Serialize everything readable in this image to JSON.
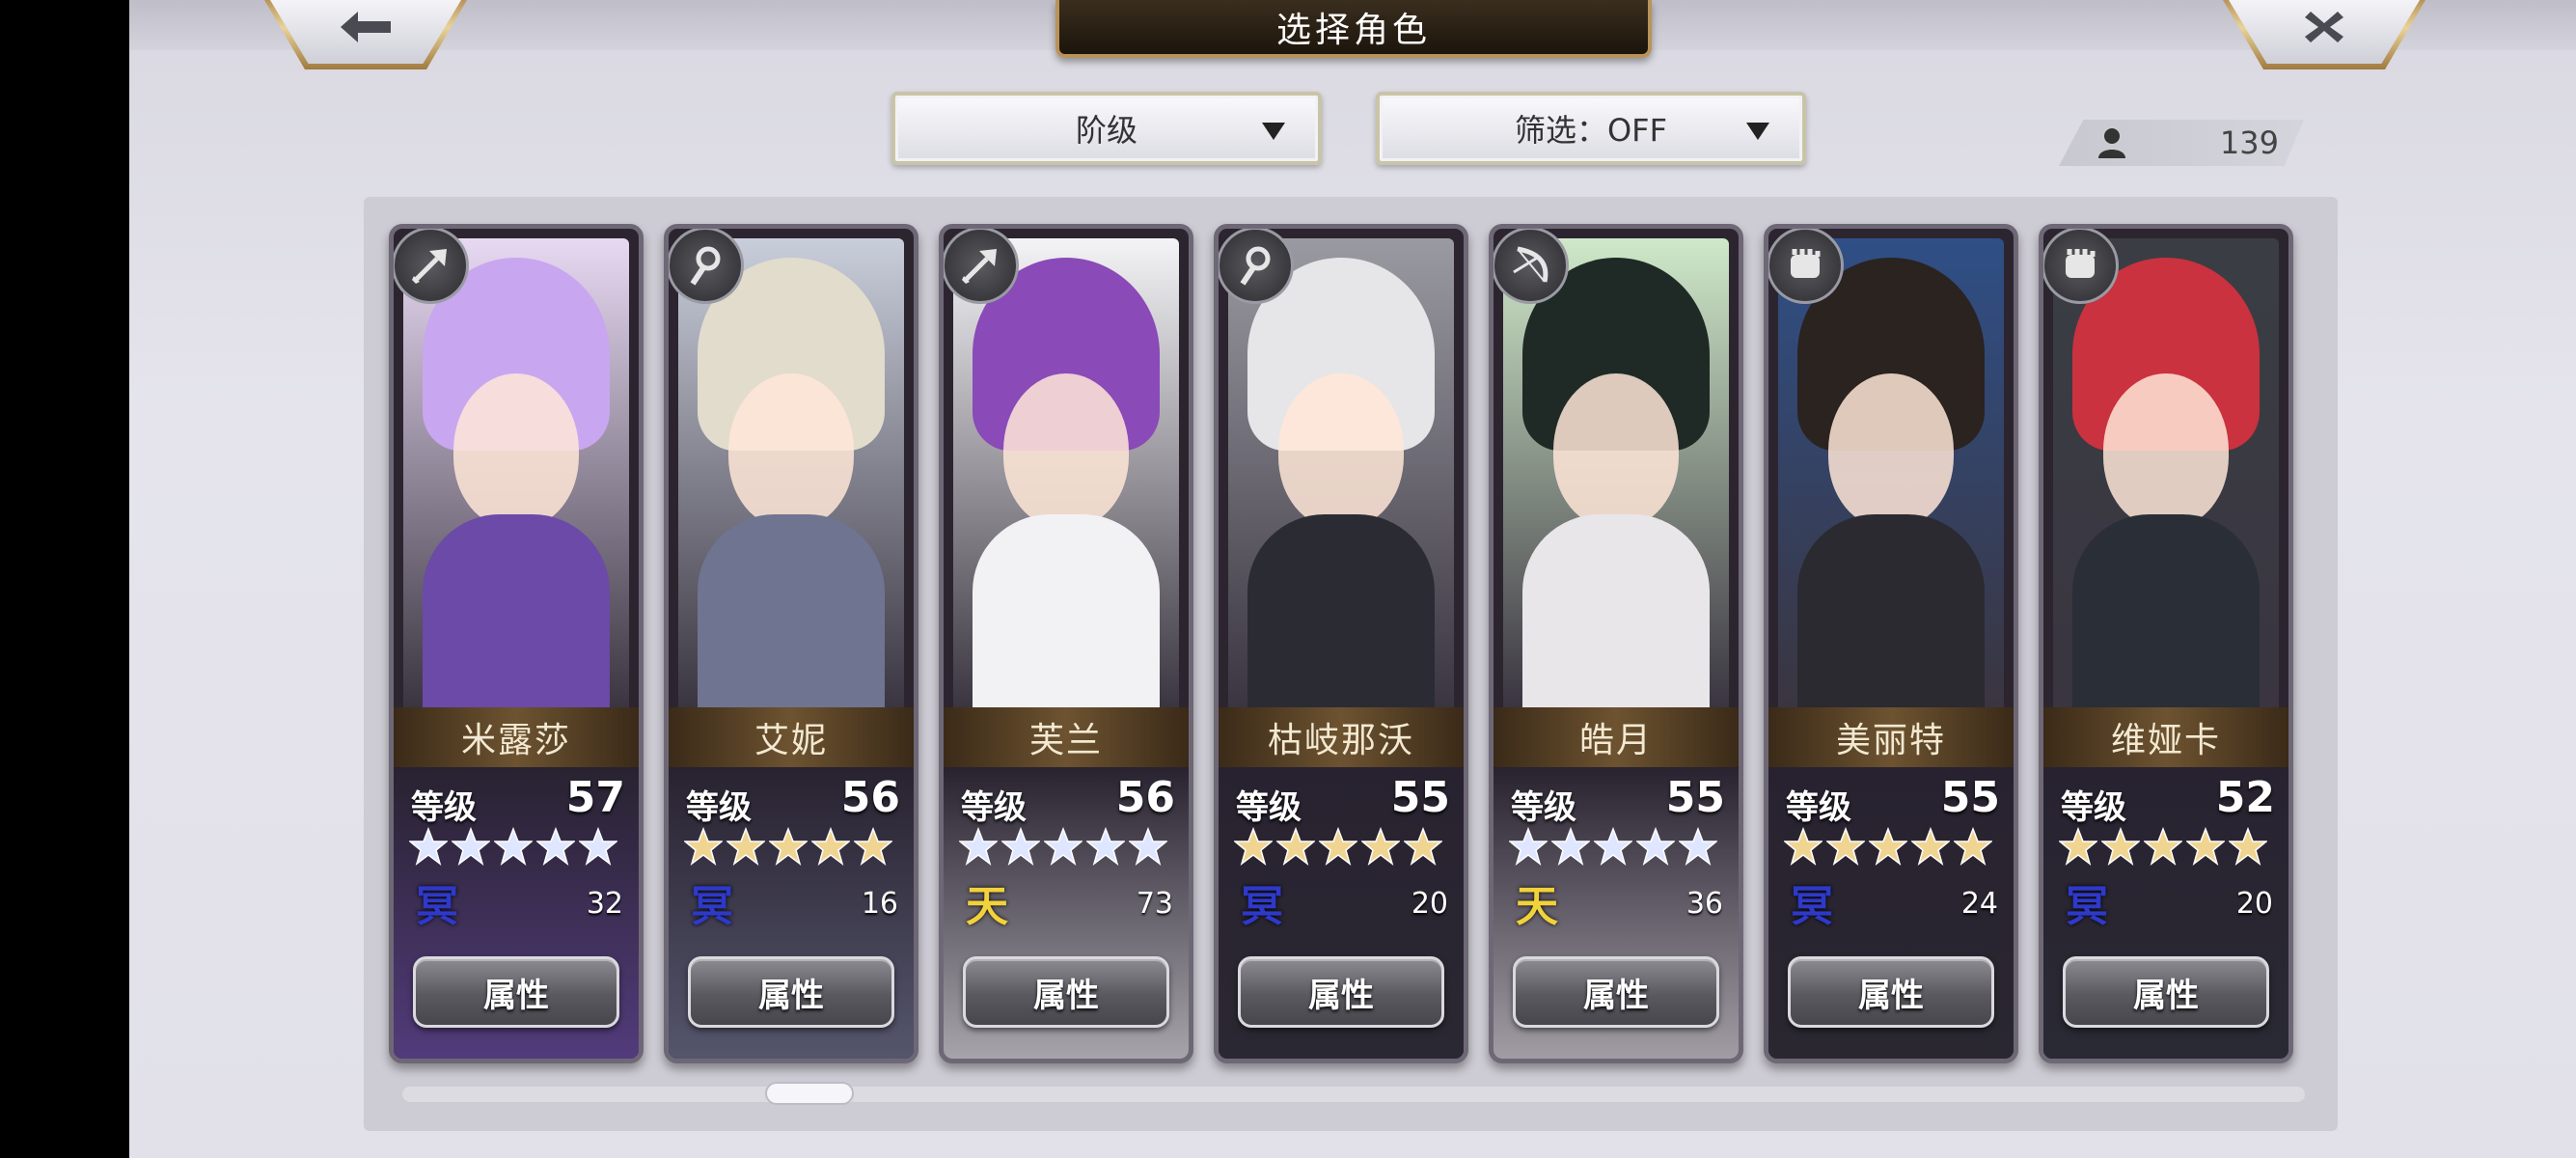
{
  "header": {
    "title": "选择角色",
    "back_icon": "arrow-left-icon",
    "close_icon": "close-icon"
  },
  "filters": {
    "rank_label": "阶级",
    "filter_label": "筛选：OFF"
  },
  "roster_count": "139",
  "characters": [
    {
      "name": "米露莎",
      "level_label": "等级",
      "level": "57",
      "stars": 5,
      "star_color": "#dfe6ff",
      "element_glyph": "冥",
      "element_color": "#2e39c9",
      "element_value": "32",
      "attr_label": "属性",
      "class_icon": "arrow-icon",
      "portrait": {
        "hair": "#c9a6f0",
        "body": "#6b4aa8",
        "bg": "#e7d9f2"
      }
    },
    {
      "name": "艾妮",
      "level_label": "等级",
      "level": "56",
      "stars": 5,
      "star_color": "#f0d592",
      "element_glyph": "冥",
      "element_color": "#2e39c9",
      "element_value": "16",
      "attr_label": "属性",
      "class_icon": "staff-icon",
      "portrait": {
        "hair": "#e2dccd",
        "body": "#6f7490",
        "bg": "#c9cedb"
      }
    },
    {
      "name": "芙兰",
      "level_label": "等级",
      "level": "56",
      "stars": 5,
      "star_color": "#dfe6ff",
      "element_glyph": "天",
      "element_color": "#f2d23b",
      "element_value": "73",
      "attr_label": "属性",
      "class_icon": "arrow-icon",
      "portrait": {
        "hair": "#8a4ab8",
        "body": "#f2f2f4",
        "bg": "#f4f4f6"
      }
    },
    {
      "name": "枯岐那沃",
      "level_label": "等级",
      "level": "55",
      "stars": 5,
      "star_color": "#f0d592",
      "element_glyph": "冥",
      "element_color": "#2e39c9",
      "element_value": "20",
      "attr_label": "属性",
      "class_icon": "staff-icon",
      "portrait": {
        "hair": "#e6e6e8",
        "body": "#2b2b33",
        "bg": "#9a9aa2"
      }
    },
    {
      "name": "皓月",
      "level_label": "等级",
      "level": "55",
      "stars": 5,
      "star_color": "#dfe6ff",
      "element_glyph": "天",
      "element_color": "#f2d23b",
      "element_value": "36",
      "attr_label": "属性",
      "class_icon": "bow-icon",
      "portrait": {
        "hair": "#1f2a26",
        "body": "#e9e6ea",
        "bg": "#cfe9c9"
      }
    },
    {
      "name": "美丽特",
      "level_label": "等级",
      "level": "55",
      "stars": 5,
      "star_color": "#f0d592",
      "element_glyph": "冥",
      "element_color": "#2e39c9",
      "element_value": "24",
      "attr_label": "属性",
      "class_icon": "fist-icon",
      "portrait": {
        "hair": "#2a2320",
        "body": "#2a2a30",
        "bg": "#2f4f86"
      }
    },
    {
      "name": "维娅卡",
      "level_label": "等级",
      "level": "52",
      "stars": 5,
      "star_color": "#f0d592",
      "element_glyph": "冥",
      "element_color": "#2e39c9",
      "element_value": "20",
      "attr_label": "属性",
      "class_icon": "fist-icon",
      "portrait": {
        "hair": "#c9323e",
        "body": "#2a2e36",
        "bg": "#3a3e44"
      }
    }
  ],
  "scroll_position": 0.2
}
